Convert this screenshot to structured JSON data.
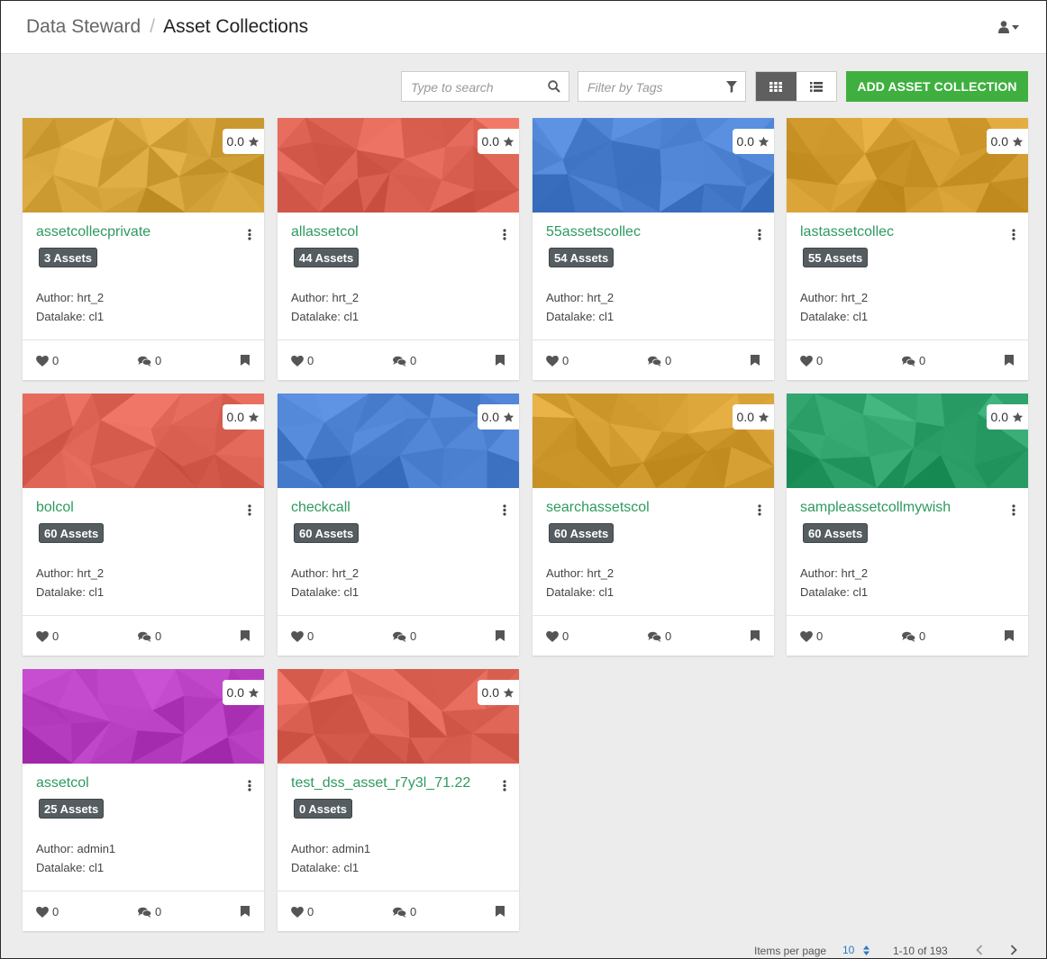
{
  "breadcrumb": {
    "root": "Data Steward",
    "separator": "/",
    "current": "Asset Collections"
  },
  "header": {
    "user_icon": "user-icon"
  },
  "toolbar": {
    "search_placeholder": "Type to search",
    "tags_placeholder": "Filter by Tags",
    "grid_view_icon": "grid-view-icon",
    "list_view_icon": "list-view-icon",
    "active_view": "grid",
    "add_label": "ADD ASSET COLLECTION"
  },
  "colors": {
    "accent_green": "#3fb03f",
    "title_green": "#2e9a5e",
    "badge": "#555d61"
  },
  "cards": [
    {
      "title": "assetcollecprivate",
      "assets": "3 Assets",
      "author": "Author: hrt_2",
      "datalake": "Datalake: cl1",
      "rating": "0.0",
      "likes": "0",
      "comments": "0",
      "banner_color": "#d4a43a"
    },
    {
      "title": "allassetcol",
      "assets": "44 Assets",
      "author": "Author: hrt_2",
      "datalake": "Datalake: cl1",
      "rating": "0.0",
      "likes": "0",
      "comments": "0",
      "banner_color": "#de6556"
    },
    {
      "title": "55assetscollec",
      "assets": "54 Assets",
      "author": "Author: hrt_2",
      "datalake": "Datalake: cl1",
      "rating": "0.0",
      "likes": "0",
      "comments": "0",
      "banner_color": "#4b7fd0"
    },
    {
      "title": "lastassetcollec",
      "assets": "55 Assets",
      "author": "Author: hrt_2",
      "datalake": "Datalake: cl1",
      "rating": "0.0",
      "likes": "0",
      "comments": "0",
      "banner_color": "#d49e32"
    },
    {
      "title": "bolcol",
      "assets": "60 Assets",
      "author": "Author: hrt_2",
      "datalake": "Datalake: cl1",
      "rating": "0.0",
      "likes": "0",
      "comments": "0",
      "banner_color": "#de6556"
    },
    {
      "title": "checkcall",
      "assets": "60 Assets",
      "author": "Author: hrt_2",
      "datalake": "Datalake: cl1",
      "rating": "0.0",
      "likes": "0",
      "comments": "0",
      "banner_color": "#4b7fd0"
    },
    {
      "title": "searchassetscol",
      "assets": "60 Assets",
      "author": "Author: hrt_2",
      "datalake": "Datalake: cl1",
      "rating": "0.0",
      "likes": "0",
      "comments": "0",
      "banner_color": "#d49e32"
    },
    {
      "title": "sampleassetcollmywish",
      "assets": "60 Assets",
      "author": "Author: hrt_2",
      "datalake": "Datalake: cl1",
      "rating": "0.0",
      "likes": "0",
      "comments": "0",
      "banner_color": "#2fa26c"
    },
    {
      "title": "assetcol",
      "assets": "25 Assets",
      "author": "Author: admin1",
      "datalake": "Datalake: cl1",
      "rating": "0.0",
      "likes": "0",
      "comments": "0",
      "banner_color": "#b83fc2"
    },
    {
      "title": "test_dss_asset_r7y3l_71.22",
      "assets": "0 Assets",
      "author": "Author: admin1",
      "datalake": "Datalake: cl1",
      "rating": "0.0",
      "likes": "0",
      "comments": "0",
      "banner_color": "#de6556"
    }
  ],
  "pagination": {
    "label": "Items per page",
    "per_page": "10",
    "range": "1-10 of 193"
  }
}
